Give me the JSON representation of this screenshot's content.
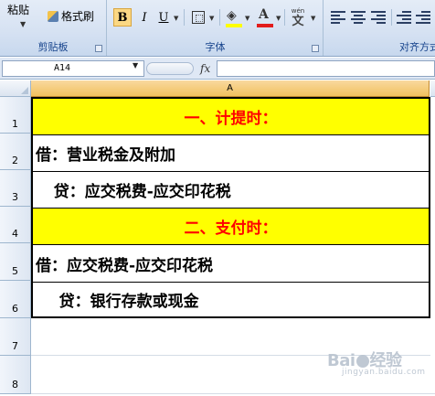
{
  "ribbon": {
    "clipboard": {
      "paste_label": "粘贴",
      "format_painter_label": "格式刷",
      "group_label": "剪贴板"
    },
    "font": {
      "bold": "B",
      "italic": "I",
      "underline": "U",
      "font_color_glyph": "A",
      "phonetic_pinyin": "wén",
      "phonetic_char": "文",
      "group_label": "字体"
    },
    "alignment": {
      "group_label": "对齐方式"
    }
  },
  "formula_bar": {
    "name_box": "A14",
    "fx": "fx",
    "formula": ""
  },
  "grid": {
    "column_header": "A",
    "row_numbers": [
      "1",
      "2",
      "3",
      "4",
      "5",
      "6",
      "7",
      "8"
    ],
    "rows": [
      "一、计提时：",
      "借：营业税金及附加",
      "   贷：应交税费-应交印花税",
      "二、支付时：",
      "借：应交税费-应交印花税",
      "    贷：银行存款或现金"
    ]
  },
  "colors": {
    "header_fill": "#ffff00",
    "header_text": "#ff0000",
    "fill_color": "#ffff00",
    "font_color": "#e21c1c"
  },
  "watermark": {
    "main": "Bai",
    "main2": "经验",
    "sub": "jingyan.baidu.com"
  }
}
